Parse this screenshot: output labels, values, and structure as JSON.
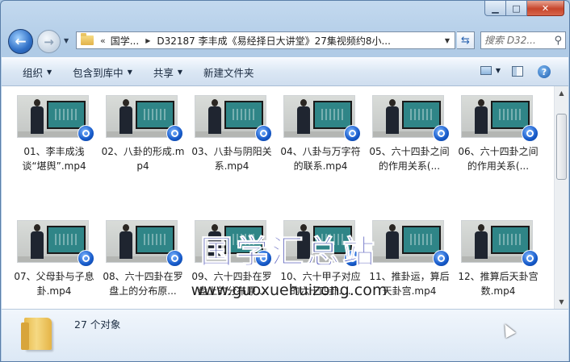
{
  "window": {
    "caption_minimize": "▁",
    "caption_maximize": "□",
    "caption_close": "✕"
  },
  "nav": {
    "back_glyph": "←",
    "forward_glyph": "→",
    "address_overflow": "«",
    "breadcrumb": [
      "国学...",
      "D32187 李丰成《易经择日大讲堂》27集视频约8小..."
    ],
    "search_placeholder": "搜索 D32...",
    "refresh_glyph": "⇆",
    "search_glyph": "⚲"
  },
  "toolbar": {
    "items": [
      {
        "label": "组织",
        "has_menu": true
      },
      {
        "label": "包含到库中",
        "has_menu": true
      },
      {
        "label": "共享",
        "has_menu": true
      },
      {
        "label": "新建文件夹",
        "has_menu": false
      }
    ],
    "help_glyph": "?"
  },
  "files": [
    {
      "name": "01、李丰成浅谈“堪舆”.mp4"
    },
    {
      "name": "02、八卦的形成.mp4"
    },
    {
      "name": "03、八卦与阴阳关系.mp4"
    },
    {
      "name": "04、八卦与万字符的联系.mp4"
    },
    {
      "name": "05、六十四卦之间的作用关系(..."
    },
    {
      "name": "06、六十四卦之间的作用关系(..."
    },
    {
      "name": "07、父母卦与子息卦.mp4"
    },
    {
      "name": "08、六十四卦在罗盘上的分布原..."
    },
    {
      "name": "09、六十四卦在罗盘上的分布原..."
    },
    {
      "name": "10、六十甲子对应的六十四卦...."
    },
    {
      "name": "11、推卦运，算后天卦宫.mp4"
    },
    {
      "name": "12、推算后天卦宫数.mp4"
    }
  ],
  "watermark": {
    "chinese": "国学汇总站",
    "url": "www.guoxuehuizong.com"
  },
  "details": {
    "item_count": "27 个对象"
  },
  "colors": {
    "watermark_blue": "#2830aa",
    "media_icon_blue": "#1559c9",
    "close_red": "#c6452b"
  }
}
